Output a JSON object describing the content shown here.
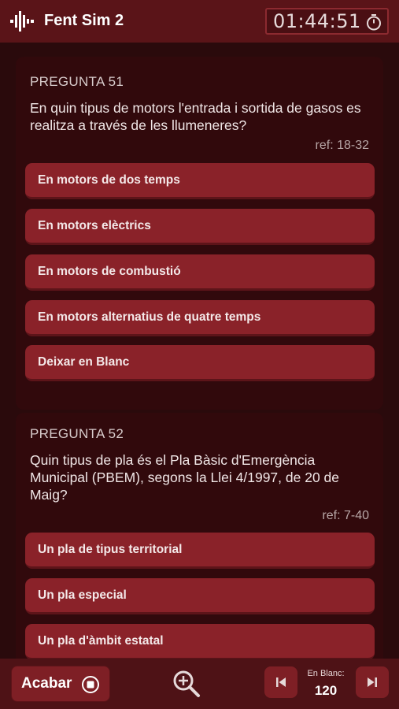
{
  "header": {
    "app_icon": "sound-wave-icon",
    "title": "Fent Sim 2",
    "timer": "01:44:51",
    "timer_icon": "stopwatch-icon"
  },
  "questions": [
    {
      "number_label": "PREGUNTA 51",
      "text": "En quin tipus de motors l'entrada i sortida de gasos es realitza a través de les llumeneres?",
      "ref": "ref: 18-32",
      "options": [
        "En motors de dos temps",
        "En motors elèctrics",
        "En motors de combustió",
        "En motors alternatius de quatre temps",
        "Deixar en Blanc"
      ]
    },
    {
      "number_label": "PREGUNTA 52",
      "text": "Quin tipus de pla és el Pla Bàsic d'Emergència Municipal (PBEM), segons la Llei 4/1997, de 20 de Maig?",
      "ref": "ref: 7-40",
      "options": [
        "Un pla de tipus territorial",
        "Un pla especial",
        "Un pla d'àmbit estatal"
      ]
    }
  ],
  "footer": {
    "finish_label": "Acabar",
    "finish_icon": "stop-circle-icon",
    "zoom_icon": "zoom-in-icon",
    "prev_icon": "skip-previous-icon",
    "next_icon": "skip-next-icon",
    "blank_label": "En Blanc:",
    "blank_count": "120"
  },
  "colors": {
    "background": "#2a0a0c",
    "header": "#5a1418",
    "option": "#8a2229",
    "card": "#31090c"
  }
}
